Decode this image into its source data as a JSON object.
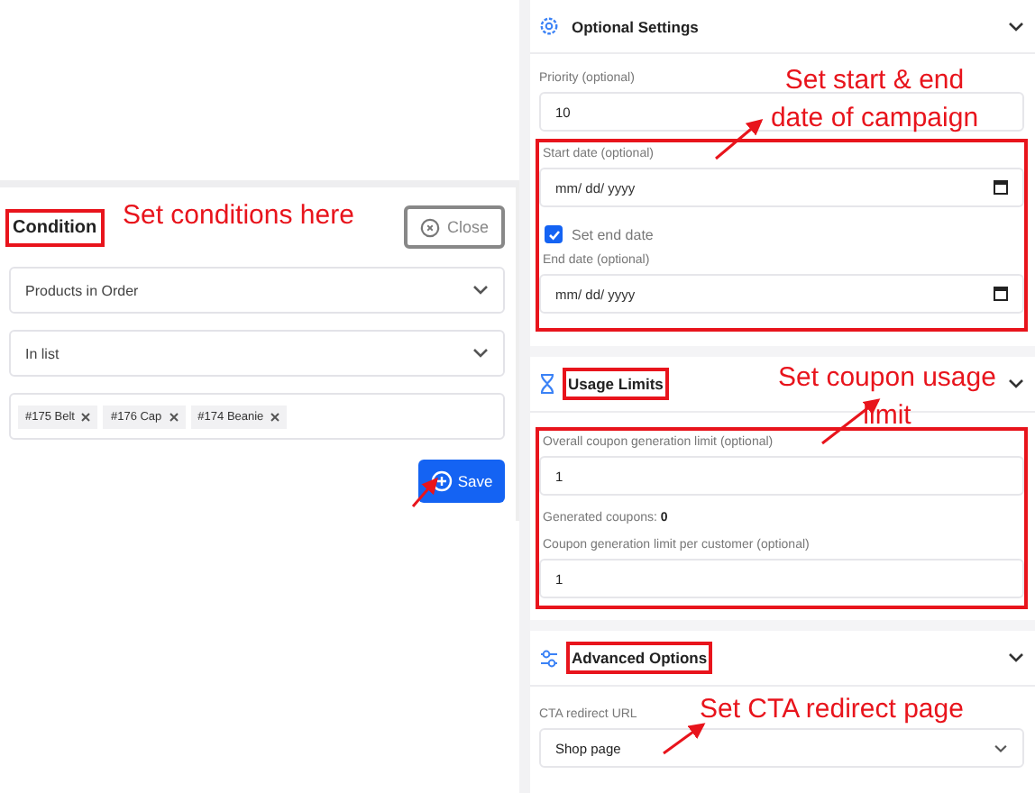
{
  "condition_panel": {
    "title": "Condition",
    "title_highlighted": true,
    "close_button": "Close",
    "selects": [
      {
        "value": "Products in Order"
      },
      {
        "value": "In list"
      }
    ],
    "tags": [
      "#175 Belt",
      "#176 Cap",
      "#174 Beanie"
    ],
    "save_button": "Save"
  },
  "optional_settings": {
    "title": "Optional Settings",
    "title_highlighted": false,
    "priority": {
      "label": "Priority (optional)",
      "value": "10"
    },
    "dates_highlighted": true,
    "start_date": {
      "label": "Start date (optional)",
      "placeholder": "mm/ dd/ yyyy"
    },
    "set_end_date": {
      "label": "Set end date",
      "checked": true
    },
    "end_date": {
      "label": "End date (optional)",
      "placeholder": "mm/ dd/ yyyy"
    }
  },
  "usage_limits": {
    "title": "Usage Limits",
    "title_highlighted": true,
    "fields_highlighted": true,
    "overall_limit": {
      "label": "Overall coupon generation limit (optional)",
      "value": "1"
    },
    "generated": {
      "label": "Generated coupons:",
      "value": "0"
    },
    "per_customer_limit": {
      "label": "Coupon generation limit per customer (optional)",
      "value": "1"
    }
  },
  "advanced_options": {
    "title": "Advanced Options",
    "title_highlighted": true,
    "cta_redirect": {
      "label": "CTA redirect URL",
      "value": "Shop page"
    }
  },
  "annotations": [
    {
      "lines": [
        "Set conditions here"
      ]
    },
    {
      "lines": [
        "Set start & end",
        "date of campaign"
      ]
    },
    {
      "lines": [
        "Set coupon usage",
        "limit"
      ]
    },
    {
      "lines": [
        "Set CTA redirect page"
      ]
    }
  ]
}
